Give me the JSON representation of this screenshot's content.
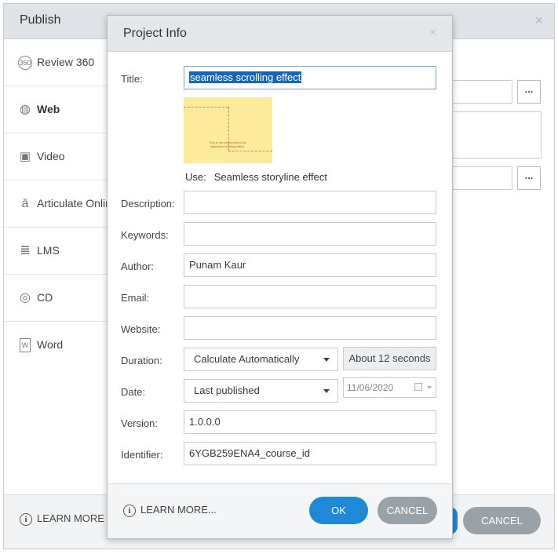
{
  "publish": {
    "title": "Publish",
    "close_icon": "×",
    "sidebar": [
      {
        "label": "Review 360",
        "icon": "review-360-icon",
        "glyph": "360"
      },
      {
        "label": "Web",
        "icon": "globe-icon",
        "glyph": "◍",
        "active": true
      },
      {
        "label": "Video",
        "icon": "video-icon",
        "glyph": "▣"
      },
      {
        "label": "Articulate Online",
        "icon": "articulate-online-icon",
        "glyph": "ā"
      },
      {
        "label": "LMS",
        "icon": "database-icon",
        "glyph": "≣"
      },
      {
        "label": "CD",
        "icon": "disc-icon",
        "glyph": "◎"
      },
      {
        "label": "Word",
        "icon": "word-doc-icon",
        "glyph": "W"
      }
    ],
    "learn_more": "LEARN MORE ...",
    "cancel_label": "CANCEL",
    "dots_label": "..."
  },
  "dialog": {
    "title": "Project Info",
    "close_icon": "×",
    "labels": {
      "title": "Title:",
      "description": "Description:",
      "keywords": "Keywords:",
      "author": "Author:",
      "email": "Email:",
      "website": "Website:",
      "duration": "Duration:",
      "date": "Date:",
      "version": "Version:",
      "identifier": "Identifier:"
    },
    "values": {
      "title": "seamless scrolling effect",
      "description": "",
      "keywords": "",
      "author": "Punam Kaur",
      "email": "",
      "website": "",
      "duration_mode": "Calculate Automatically",
      "duration_value": "About 12 seconds",
      "date_mode": "Last published",
      "date_value": "11/06/2020",
      "version": "1.0.0.0",
      "identifier": "6YGB259ENA4_course_id"
    },
    "thumbnail_text": "This is the beginning of the seamless scrolling effect.",
    "use_label": "Use:",
    "use_value": "Seamless storyline effect",
    "learn_more": "LEARN MORE...",
    "ok_label": "OK",
    "cancel_label": "CANCEL"
  },
  "colors": {
    "primary_button": "#1e88d9",
    "secondary_button": "#9aa2a9",
    "selection": "#1566c0",
    "thumbnail_bg": "#fdeb9a"
  }
}
